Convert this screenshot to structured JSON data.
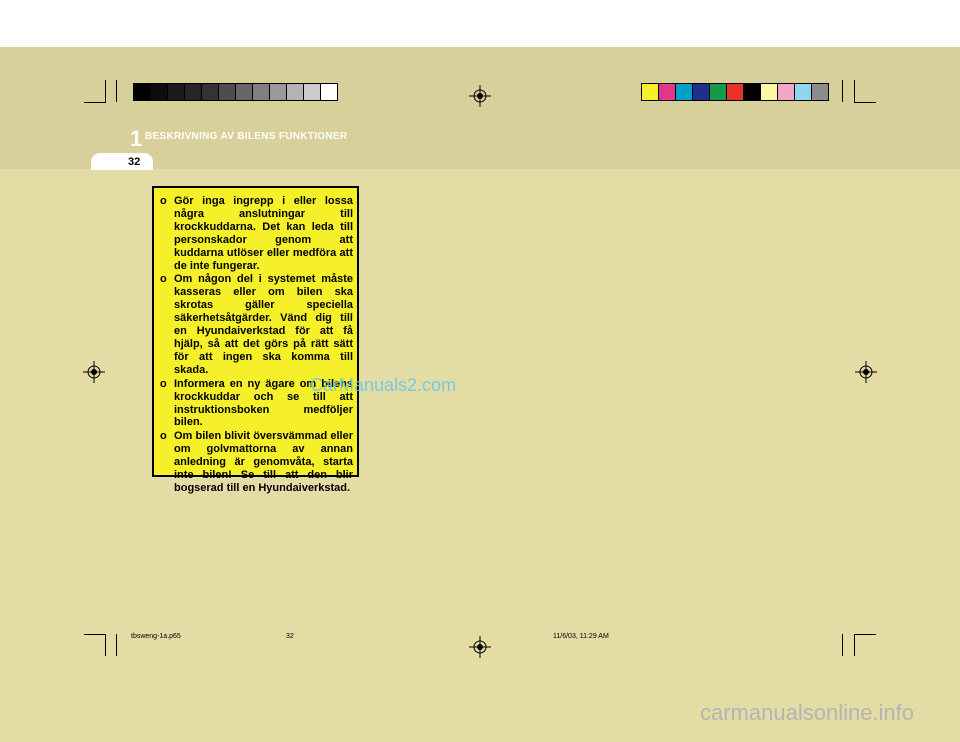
{
  "header": {
    "chapter_number": "1",
    "chapter_title": "BESKRIVNING AV BILENS FUNKTIONER",
    "page_number": "32"
  },
  "warning": {
    "items": [
      {
        "bullet": "o",
        "text": "Gör inga ingrepp i eller lossa några anslutningar till krockkuddarna. Det kan leda till personskador genom att kuddarna utlöser eller medföra att de inte fungerar."
      },
      {
        "bullet": "o",
        "text": "Om någon del i systemet måste kasseras eller om bilen ska skrotas gäller speciella säkerhetsåtgärder. Vänd dig till en Hyundaiverkstad för att få hjälp, så att det görs på rätt sätt för att ingen ska komma till skada."
      },
      {
        "bullet": "o",
        "text": "Informera en ny ägare om bilens krockkuddar och se till att instruktionsboken medföljer bilen."
      },
      {
        "bullet": "o",
        "text": "Om bilen blivit översvämmad eller om golvmattorna av annan anledning är genomvåta, starta inte bilen! Se till att den blir bogserad till en Hyundaiverkstad."
      }
    ]
  },
  "watermark_overlay": "CarManuals2.com",
  "footer": {
    "filename": "tbsweng-1a.p65",
    "page": "32",
    "timestamp": "11/6/03, 11:29 AM"
  },
  "source_watermark": "carmanualsonline.info",
  "colors": {
    "page_background": "#e4dca5",
    "warning_background": "#f6f02a",
    "gray_swatches": [
      "#000000",
      "#0d0d0d",
      "#1a1a1a",
      "#262626",
      "#333333",
      "#4d4d4d",
      "#666666",
      "#808080",
      "#999999",
      "#b3b3b3",
      "#cccccc",
      "#ffffff"
    ],
    "cmyk_swatches": [
      "#f6f02a",
      "#e0368c",
      "#00a0c8",
      "#1e2f8c",
      "#149a4a",
      "#e8322a",
      "#000000",
      "#fff7a8",
      "#f4a6c8",
      "#8ed6ec",
      "#8c8c8c"
    ]
  }
}
